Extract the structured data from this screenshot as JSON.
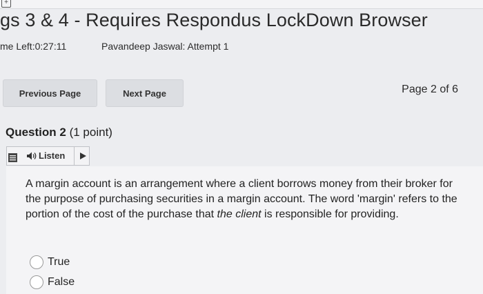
{
  "header": {
    "title": "gs 3 & 4 - Requires Respondus LockDown Browser",
    "time_left": "me Left:0:27:11",
    "attempt": "Pavandeep Jaswal: Attempt 1"
  },
  "navigation": {
    "previous_label": "Previous Page",
    "next_label": "Next Page",
    "page_indicator": "Page 2 of 6"
  },
  "question": {
    "number": "Question 2",
    "points": "(1 point)",
    "listen_label": "Listen",
    "text_before": "A margin account is an arrangement where a client borrows money from their broker for the purpose of purchasing securities in a margin account. The word 'margin' refers to the portion of the cost of the purchase that ",
    "text_em": "the client",
    "text_after": " is responsible for providing.",
    "options": [
      {
        "label": "True"
      },
      {
        "label": "False"
      }
    ]
  },
  "icons": {
    "top": "plus-square-icon",
    "menu": "menu-icon",
    "speaker": "speaker-icon",
    "play": "play-icon"
  }
}
